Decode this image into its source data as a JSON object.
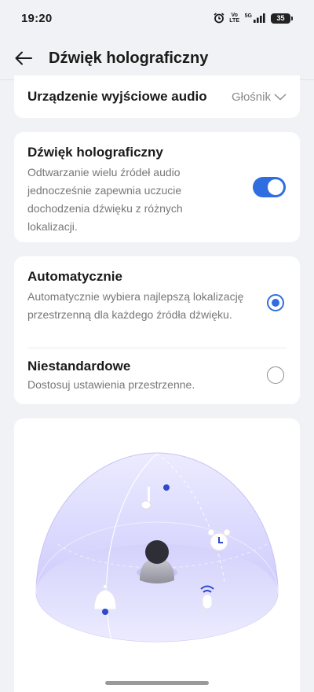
{
  "status_bar": {
    "time": "19:20",
    "volte": "Vo LTE",
    "network": "5G",
    "battery": "35"
  },
  "header": {
    "title": "Dźwięk holograficzny"
  },
  "output_device": {
    "label": "Urządzenie wyjściowe audio",
    "value": "Głośnik"
  },
  "holographic": {
    "title": "Dźwięk holograficzny",
    "description": "Odtwarzanie wielu źródeł audio jednocześnie zapewnia uczucie dochodzenia dźwięku z różnych lokalizacji.",
    "enabled": true
  },
  "modes": [
    {
      "title": "Automatycznie",
      "description": "Automatycznie wybiera najlepszą lokalizację przestrzenną dla każdego źródła dźwięku.",
      "selected": true
    },
    {
      "title": "Niestandardowe",
      "description": "Dostosuj ustawienia przestrzenne.",
      "selected": false
    }
  ],
  "illustration": {
    "icons": [
      "music-note-icon",
      "alarm-clock-icon",
      "bell-icon",
      "microphone-icon",
      "listener-avatar"
    ],
    "accent_color": "#2f6de1",
    "dome_color": "#c9c8fb"
  }
}
